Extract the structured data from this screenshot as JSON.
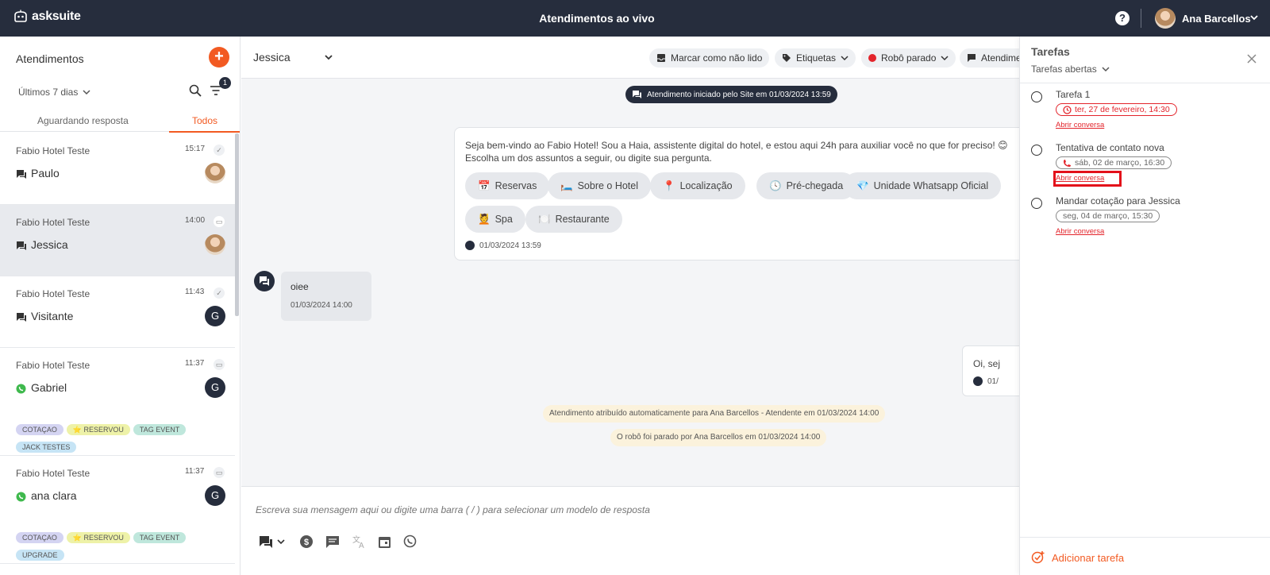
{
  "app": {
    "logo_text": "asksuite",
    "page_title": "Atendimentos ao vivo",
    "user_name": "Ana Barcellos"
  },
  "left": {
    "title": "Atendimentos",
    "period": "Últimos 7 dias",
    "filter_count": "1",
    "tabs": [
      "Aguardando resposta",
      "Todos"
    ],
    "conversations": [
      {
        "company": "Fabio Hotel Teste",
        "time": "15:17",
        "name": "Paulo",
        "channel": "chat",
        "avatar": "photo",
        "tags": []
      },
      {
        "company": "Fabio Hotel Teste",
        "time": "14:00",
        "name": "Jessica",
        "channel": "chat",
        "avatar": "photo",
        "tags": []
      },
      {
        "company": "Fabio Hotel Teste",
        "time": "11:43",
        "name": "Visitante",
        "channel": "chat",
        "avatar": "G",
        "tags": []
      },
      {
        "company": "Fabio Hotel Teste",
        "time": "11:37",
        "name": "Gabriel",
        "channel": "whatsapp",
        "avatar": "G",
        "tags": [
          "COTAÇAO",
          "⭐ RESERVOU",
          "TAG EVENT",
          "JACK TESTES"
        ]
      },
      {
        "company": "Fabio Hotel Teste",
        "time": "11:37",
        "name": "ana clara",
        "channel": "whatsapp",
        "avatar": "G",
        "tags": [
          "COTAÇAO",
          "⭐ RESERVOU",
          "TAG EVENT",
          "UPGRADE"
        ]
      }
    ]
  },
  "chat": {
    "contact": "Jessica",
    "actions": {
      "mark_unread": "Marcar como não lido",
      "labels": "Etiquetas",
      "robot": "Robô parado",
      "attend": "Atendime"
    },
    "system_pill": "Atendimento iniciado pelo Site em 01/03/2024 13:59",
    "bot_message": {
      "line1": "Seja bem-vindo ao Fabio Hotel! Sou a Haia, assistente digital do hotel, e estou aqui 24h para auxiliar você no que for preciso! 😊",
      "line2": "Escolha um dos assuntos a seguir, ou digite sua pergunta.",
      "quick_replies": [
        {
          "icon": "📅",
          "label": "Reservas"
        },
        {
          "icon": "🛏️",
          "label": "Sobre o Hotel"
        },
        {
          "icon": "📍",
          "label": "Localização"
        },
        {
          "icon": "🕓",
          "label": "Pré-chegada"
        },
        {
          "icon": "💎",
          "label": "Unidade Whatsapp Oficial"
        },
        {
          "icon": "💆",
          "label": "Spa"
        },
        {
          "icon": "🍽️",
          "label": "Restaurante"
        }
      ],
      "time": "01/03/2024 13:59"
    },
    "user_message": {
      "text": "oiee",
      "time": "01/03/2024 14:00"
    },
    "agent_message": {
      "text": "Oi, sej",
      "time": "01/"
    },
    "notices": [
      "Atendimento atribuído automaticamente para Ana Barcellos - Atendente em 01/03/2024 14:00",
      "O robô foi parado por Ana Barcellos em 01/03/2024 14:00"
    ],
    "composer_placeholder": "Escreva sua mensagem aqui ou digite uma barra ( / ) para selecionar um modelo de resposta"
  },
  "tasks": {
    "title": "Tarefas",
    "filter": "Tarefas abertas",
    "items": [
      {
        "name": "Tarefa 1",
        "date": "ter, 27 de fevereiro, 14:30",
        "overdue": true,
        "link": "Abrir conversa"
      },
      {
        "name": "Tentativa de contato nova",
        "date": "sáb, 02 de março, 16:30",
        "overdue": false,
        "link": "Abrir conversa"
      },
      {
        "name": "Mandar cotação para Jessica",
        "date": "seg, 04 de março, 15:30",
        "overdue": false,
        "link": "Abrir conversa"
      }
    ],
    "add_label": "Adicionar tarefa"
  },
  "colors": {
    "topbar": "#262d3d",
    "accent": "#f25a22",
    "danger": "#e3242b"
  }
}
